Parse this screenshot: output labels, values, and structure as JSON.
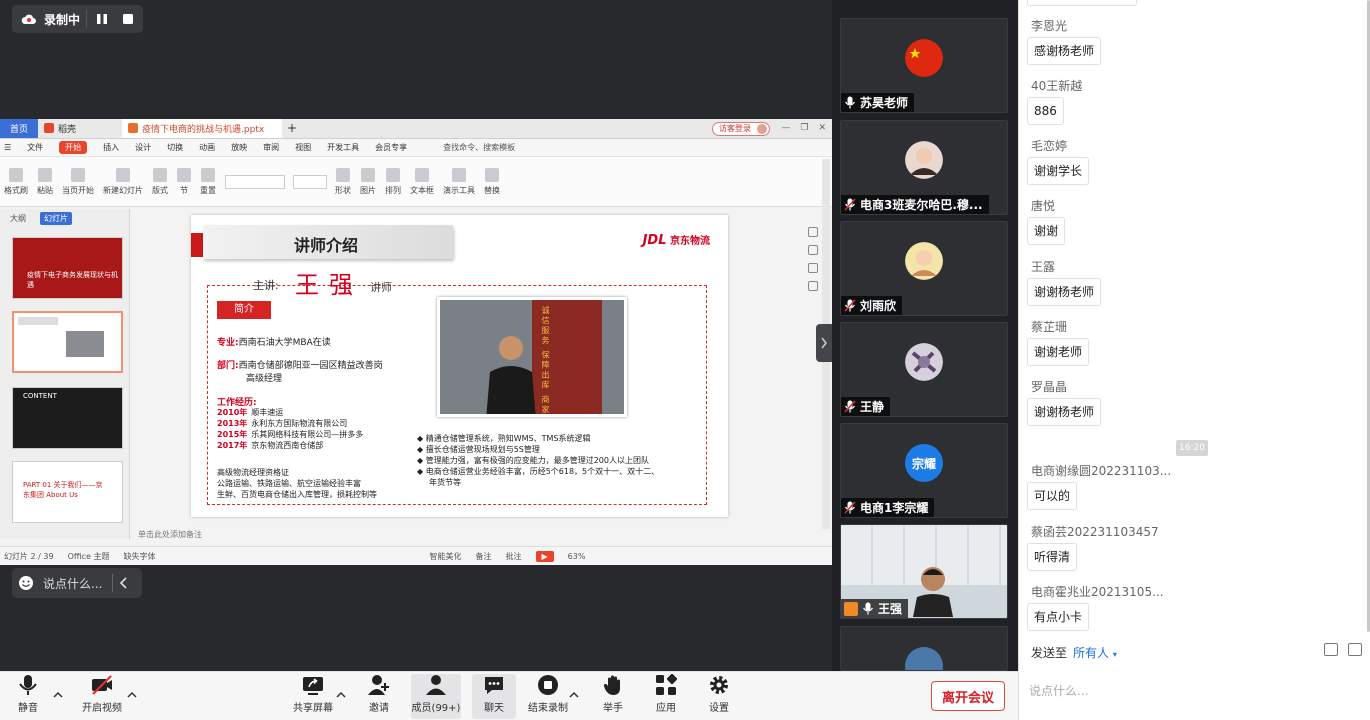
{
  "recording": {
    "label": "录制中"
  },
  "share": {
    "tabs": {
      "home": "首页",
      "daoke": "稻壳",
      "doc": "疫情下电商的挑战与机遇.pptx",
      "add": "+"
    },
    "login_label": "访客登录",
    "menu": [
      "文件",
      "开始",
      "插入",
      "设计",
      "切换",
      "动画",
      "放映",
      "审阅",
      "视图",
      "开发工具",
      "会员专享"
    ],
    "menu_active_index": 1,
    "command_search": "查找命令、搜索模板",
    "ribbon": [
      "格式刷",
      "粘贴",
      "当页开始",
      "新建幻灯片",
      "版式",
      "节",
      "重置"
    ],
    "ribbon_right": [
      "形状",
      "图片",
      "排列",
      "文本框",
      "演示工具",
      "替换"
    ],
    "side_tabs": [
      "大纲",
      "幻灯片"
    ],
    "thumbnails": [
      {
        "num": "1",
        "title": "疫情下电子商务发展现状与机遇"
      },
      {
        "num": "2",
        "title": ""
      },
      {
        "num": "3",
        "title": "CONTENT"
      },
      {
        "num": "4",
        "title": "PART 01 关于我们——京东集团 About Us"
      }
    ],
    "slide": {
      "title": "讲师介绍",
      "logo_mark": "JDL",
      "logo_text": "京东物流",
      "lecturer_label": "主讲:",
      "lecturer_name": "王强",
      "lecturer_role": "讲师",
      "intro_label": "简介",
      "major_label": "专业:",
      "major_value": "西南石油大学MBA在读",
      "dept_label": "部门:",
      "dept_value_1": "西南仓储部德阳亚一园区精益改善岗",
      "dept_value_2": "高级经理",
      "exp_title": "工作经历:",
      "experience": [
        {
          "year": "2010年",
          "org": "顺丰速运"
        },
        {
          "year": "2013年",
          "org": "永利东方国际物流有限公司"
        },
        {
          "year": "2015年",
          "org": "乐其网络科技有限公司—拼多多"
        },
        {
          "year": "2017年",
          "org": "京东物流西南仓储部"
        }
      ],
      "qualifications": [
        "高级物流经理资格证",
        "公路运输、铁路运输、航空运输经验丰富",
        "生鲜、百货电商仓储出入库管理，损耗控制等"
      ],
      "banner_text": "诚信服务 保障出库 商家",
      "bullets": [
        "◆ 精通仓储管理系统，熟知WMS、TMS系统逻辑",
        "◆ 擅长仓储运营现场规划与5S管理",
        "◆ 管理能力强，富有极强的应变能力，最多管理过200人以上团队",
        "◆ 电商仓储运营业务经验丰富，历经5个618，5个双十一、双十二、",
        "年货节等"
      ]
    },
    "notes_placeholder": "单击此处添加备注",
    "status": {
      "page": "幻灯片 2 / 39",
      "theme": "Office 主题",
      "font": "缺失字体",
      "beautify": "智能美化",
      "notes": "备注",
      "comment": "批注",
      "zoom": "63%"
    }
  },
  "say_box": {
    "placeholder": "说点什么..."
  },
  "participants": [
    {
      "name": "苏昊老师",
      "avatar_kind": "flag"
    },
    {
      "name": "电商3班麦尔哈巴.穆...",
      "avatar_kind": "photo"
    },
    {
      "name": "刘雨欣",
      "avatar_kind": "photo"
    },
    {
      "name": "王静",
      "avatar_kind": "photo"
    },
    {
      "name": "电商1李宗耀",
      "avatar_kind": "text",
      "avatar_text": "宗耀"
    },
    {
      "name": "王强",
      "avatar_kind": "video"
    }
  ],
  "chat": {
    "messages": [
      {
        "sender": "李恩光",
        "text": "感谢杨老师"
      },
      {
        "sender": "40王新越",
        "text": "886"
      },
      {
        "sender": "毛恋婷",
        "text": "谢谢学长"
      },
      {
        "sender": "唐悦",
        "text": "谢谢"
      },
      {
        "sender": "王露",
        "text": "谢谢杨老师"
      },
      {
        "sender": "蔡芷珊",
        "text": "谢谢老师"
      },
      {
        "sender": "罗晶晶",
        "text": "谢谢杨老师"
      },
      {
        "sender": "电商谢缘圆202231103...",
        "text": "可以的"
      },
      {
        "sender": "蔡函芸202231103457",
        "text": "听得清"
      },
      {
        "sender": "电商霍兆业20213105...",
        "text": "有点小卡"
      }
    ],
    "time_chip": "16:20",
    "send_to_label": "发送至",
    "send_target": "所有人",
    "input_placeholder": "说点什么..."
  },
  "toolbar": {
    "mute": "静音",
    "video": "开启视频",
    "share": "共享屏幕",
    "invite": "邀请",
    "members": "成员(99+)",
    "chat": "聊天",
    "stop_record": "结束录制",
    "raise_hand": "举手",
    "apps": "应用",
    "settings": "设置",
    "leave": "离开会议"
  },
  "colors": {
    "accent": "#1e6fe0",
    "danger": "#d6202a",
    "wps_red": "#e8452c"
  }
}
